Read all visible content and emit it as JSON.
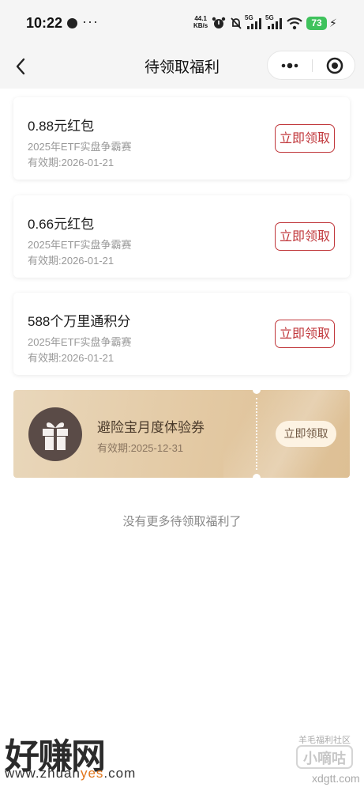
{
  "status_bar": {
    "time": "10:22",
    "dots": "···",
    "net_speed_value": "44.1",
    "net_speed_unit": "KB/s",
    "signal_1": "5G",
    "signal_2": "5G",
    "battery": "73"
  },
  "nav": {
    "title": "待领取福利"
  },
  "rewards": [
    {
      "title": "0.88元红包",
      "source": "2025年ETF实盘争霸赛",
      "expiry": "有效期:2026-01-21",
      "button": "立即领取"
    },
    {
      "title": "0.66元红包",
      "source": "2025年ETF实盘争霸赛",
      "expiry": "有效期:2026-01-21",
      "button": "立即领取"
    },
    {
      "title": "588个万里通积分",
      "source": "2025年ETF实盘争霸赛",
      "expiry": "有效期:2026-01-21",
      "button": "立即领取"
    }
  ],
  "voucher": {
    "title": "避险宝月度体验券",
    "expiry": "有效期:2025-12-31",
    "button": "立即领取",
    "icon": "gift-icon"
  },
  "footer": {
    "no_more": "没有更多待领取福利了"
  },
  "watermark": {
    "logo": "好赚网",
    "url_a": "www.zhuan",
    "url_b": "yes",
    "url_c": ".com",
    "right_line1": "羊毛福利社区",
    "right_badge": "小嘀咕",
    "right_line2": "xdgtt.com"
  },
  "colors": {
    "accent_red": "#c0363a",
    "voucher_gold": "#e3c9a3",
    "battery_green": "#3ec25c"
  }
}
